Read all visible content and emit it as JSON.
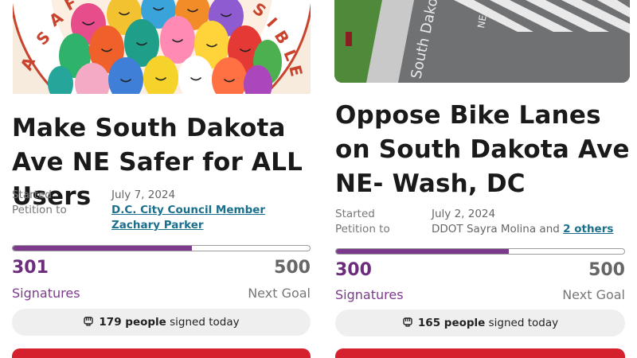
{
  "colors": {
    "accent_purple": "#7b3a8c",
    "link_blue": "#1a6f8c",
    "cta_red": "#d4212d"
  },
  "petitions": [
    {
      "hero_text": "A SAF... SIBLE",
      "title": "Make South Dakota Ave NE Safer for ALL Users",
      "started_label": "Started",
      "started_value": "July 7, 2024",
      "petition_to_label": "Petition to",
      "petition_to_link": "D.C. City Council Member Zachary Parker",
      "progress_fraction": 0.602,
      "signatures": "301",
      "goal": "500",
      "signatures_label": "Signatures",
      "goal_label": "Next Goal",
      "today_count": "179 people",
      "today_suffix": "signed today",
      "today_icon": "fist-raised-icon"
    },
    {
      "hero_road_sign": "South Dakota Ave",
      "hero_sign_suffix": "NE",
      "title": "Oppose Bike Lanes on South Dakota Ave NE- Wash, DC",
      "started_label": "Started",
      "started_value": "July 2, 2024",
      "petition_to_label": "Petition to",
      "petition_to_text": "DDOT Sayra Molina and",
      "petition_to_link": "2 others",
      "progress_fraction": 0.6,
      "signatures": "300",
      "goal": "500",
      "signatures_label": "Signatures",
      "goal_label": "Next Goal",
      "today_count": "165 people",
      "today_suffix": "signed today",
      "today_icon": "fist-raised-icon"
    }
  ]
}
